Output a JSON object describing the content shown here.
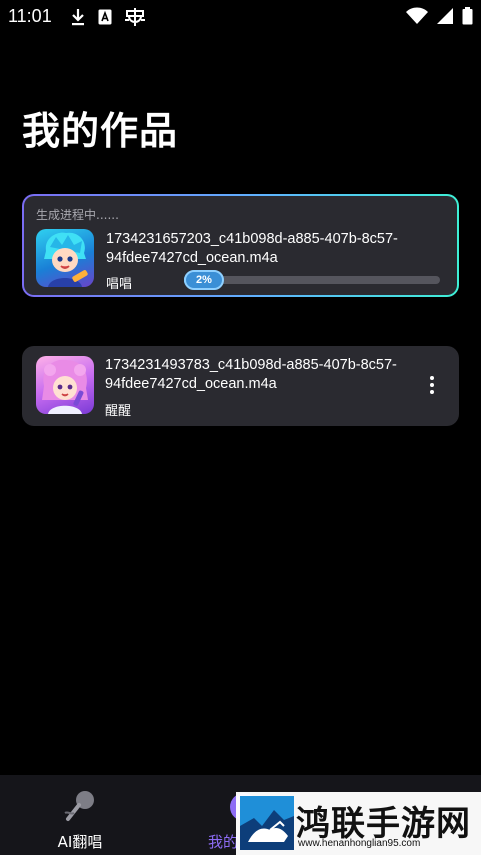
{
  "status_bar": {
    "time": "11:01",
    "icons": [
      "download-icon",
      "a-notification-icon",
      "bug-icon",
      "wifi-icon",
      "signal-icon",
      "battery-icon"
    ]
  },
  "page": {
    "title": "我的作品"
  },
  "works": [
    {
      "status": "生成进程中......",
      "filename": "1734231657203_c41b098d-a885-407b-8c57-94fdee7427cd_ocean.m4a",
      "singer": "唱唱",
      "progress_label": "2%",
      "progress": 0.02
    },
    {
      "filename": "1734231493783_c41b098d-a885-407b-8c57-94fdee7427cd_ocean.m4a",
      "singer": "醒醒"
    }
  ],
  "bottom_nav": {
    "items": [
      {
        "label": "AI翻唱",
        "icon": "microphone-icon",
        "active": false
      },
      {
        "label": "我的",
        "icon": "profile-icon",
        "active": true
      }
    ]
  },
  "watermark": {
    "text": "鸿联手游网",
    "url": "www.henanhonglian95.com"
  },
  "colors": {
    "background": "#000000",
    "card": "#2a2a30",
    "accent": "#8d6cf5",
    "progress": "#4fa8e8"
  }
}
